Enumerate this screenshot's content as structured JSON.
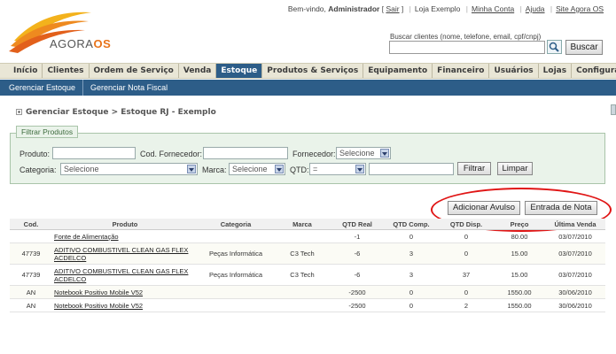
{
  "header": {
    "logo_text_a": "AGORA",
    "logo_text_b": "OS",
    "welcome_prefix": "Bem-vindo, ",
    "user": "Administrador",
    "sair": "Sair",
    "links": [
      "Loja Exemplo",
      "Minha Conta",
      "Ajuda",
      "Site Agora OS"
    ],
    "search_label": "Buscar clientes (nome, telefone, email, cpf/cnpj)",
    "search_value": "",
    "search_button": "Buscar"
  },
  "nav": {
    "items": [
      "Início",
      "Clientes",
      "Ordem de Serviço",
      "Venda",
      "Estoque",
      "Produtos & Serviços",
      "Equipamento",
      "Financeiro",
      "Usuários",
      "Lojas",
      "Configurações"
    ],
    "active": "Estoque",
    "sub_items": [
      "Gerenciar Estoque",
      "Gerenciar Nota Fiscal"
    ]
  },
  "breadcrumb": "Gerenciar Estoque > Estoque RJ - Exemplo",
  "filter": {
    "legend": "Filtrar Produtos",
    "produto_label": "Produto:",
    "cod_fornecedor_label": "Cod. Fornecedor:",
    "fornecedor_label": "Fornecedor:",
    "fornecedor_value": "Selecione",
    "categoria_label": "Categoria:",
    "categoria_value": "Selecione",
    "marca_label": "Marca:",
    "marca_value": "Selecione",
    "qtd_label": "QTD:",
    "qtd_operator": "=",
    "filtrar_button": "Filtrar",
    "limpar_button": "Limpar"
  },
  "actions": {
    "adicionar_avulso": "Adicionar Avulso",
    "entrada_nota": "Entrada de Nota"
  },
  "annotation_color": "#e01515",
  "accent_color": "#2d5d88",
  "table": {
    "headers": [
      "Cod.",
      "Produto",
      "Categoria",
      "Marca",
      "QTD Real",
      "QTD Comp.",
      "QTD Disp.",
      "Preço",
      "Última Venda"
    ],
    "rows": [
      {
        "cod": "",
        "produto": "Fonte de Alimentação",
        "categoria": "",
        "marca": "",
        "qtd_real": "-1",
        "qtd_comp": "0",
        "qtd_disp": "0",
        "preco": "80.00",
        "ultima_venda": "03/07/2010"
      },
      {
        "cod": "47739",
        "produto": "ADITIVO COMBUSTIVEL CLEAN GAS FLEX ACDELCO",
        "categoria": "Peças Informática",
        "marca": "C3 Tech",
        "qtd_real": "-6",
        "qtd_comp": "3",
        "qtd_disp": "0",
        "preco": "15.00",
        "ultima_venda": "03/07/2010"
      },
      {
        "cod": "47739",
        "produto": "ADITIVO COMBUSTIVEL CLEAN GAS FLEX ACDELCO",
        "categoria": "Peças Informática",
        "marca": "C3 Tech",
        "qtd_real": "-6",
        "qtd_comp": "3",
        "qtd_disp": "37",
        "preco": "15.00",
        "ultima_venda": "03/07/2010"
      },
      {
        "cod": "AN",
        "produto": "Notebook Positivo Mobile V52",
        "categoria": "",
        "marca": "",
        "qtd_real": "-2500",
        "qtd_comp": "0",
        "qtd_disp": "0",
        "preco": "1550.00",
        "ultima_venda": "30/06/2010"
      },
      {
        "cod": "AN",
        "produto": "Notebook Positivo Mobile V52",
        "categoria": "",
        "marca": "",
        "qtd_real": "-2500",
        "qtd_comp": "0",
        "qtd_disp": "2",
        "preco": "1550.00",
        "ultima_venda": "30/06/2010"
      }
    ]
  }
}
